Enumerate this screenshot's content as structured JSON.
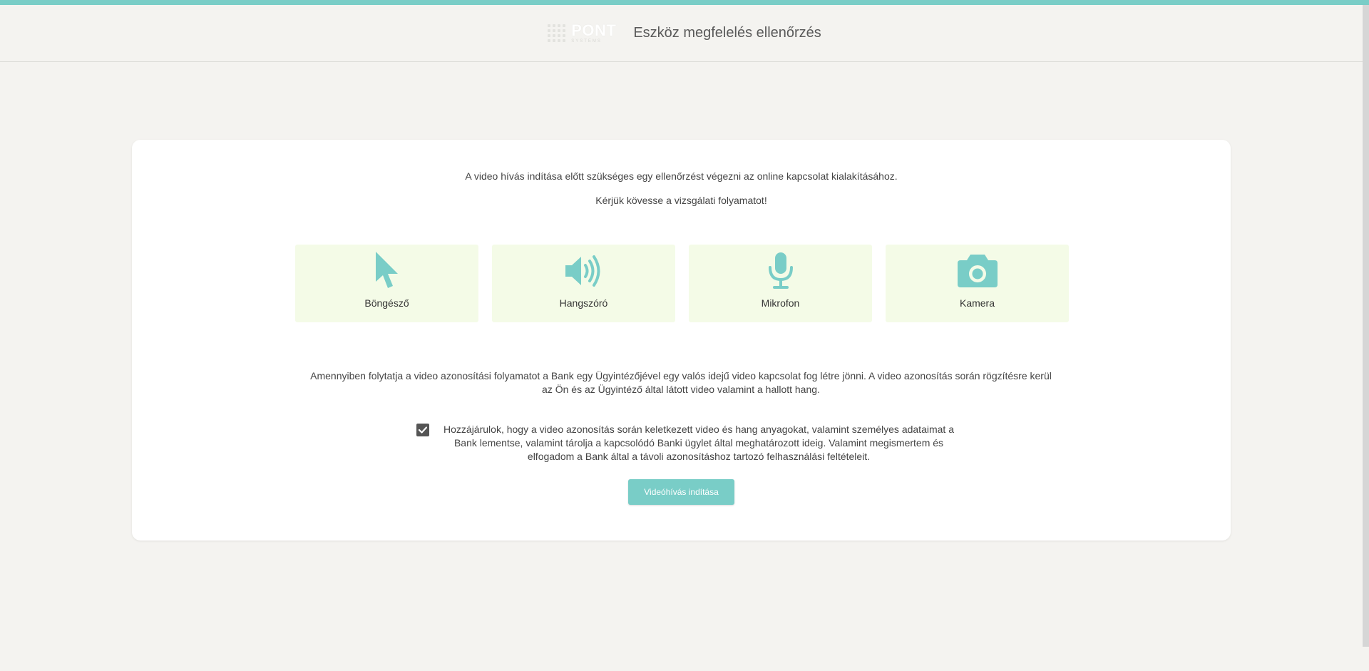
{
  "header": {
    "logo_text": "PONT",
    "logo_subtext": "SYSTEMS",
    "title": "Eszköz megfelelés ellenőrzés"
  },
  "intro": {
    "line1": "A video hívás indítása előtt szükséges egy ellenőrzést végezni az online kapcsolat kialakításához.",
    "line2": "Kérjük kövesse a vizsgálati folyamatot!"
  },
  "checks": [
    {
      "label": "Böngésző",
      "icon": "cursor-icon"
    },
    {
      "label": "Hangszóró",
      "icon": "speaker-icon"
    },
    {
      "label": "Mikrofon",
      "icon": "microphone-icon"
    },
    {
      "label": "Kamera",
      "icon": "camera-icon"
    }
  ],
  "notice": "Amennyiben folytatja a video azonosítási folyamatot a Bank egy Ügyintézőjével egy valós idejű video kapcsolat fog létre jönni. A video azonosítás során rögzítésre kerül az Ön és az Ügyintéző által látott video valamint a hallott hang.",
  "consent": {
    "checked": true,
    "text": "Hozzájárulok, hogy a video azonosítás során keletkezett video és hang anyagokat, valamint személyes adataimat a Bank lementse, valamint tárolja a kapcsolódó Banki ügylet által meghatározott ideig. Valamint megismertem és elfogadom a Bank által a távoli azonosításhoz tartozó felhasználási feltételeit."
  },
  "button": {
    "start_label": "Videóhívás indítása"
  },
  "colors": {
    "accent": "#79cdc7",
    "tile_bg": "#f4fbe7",
    "page_bg": "#f4f3f0"
  }
}
